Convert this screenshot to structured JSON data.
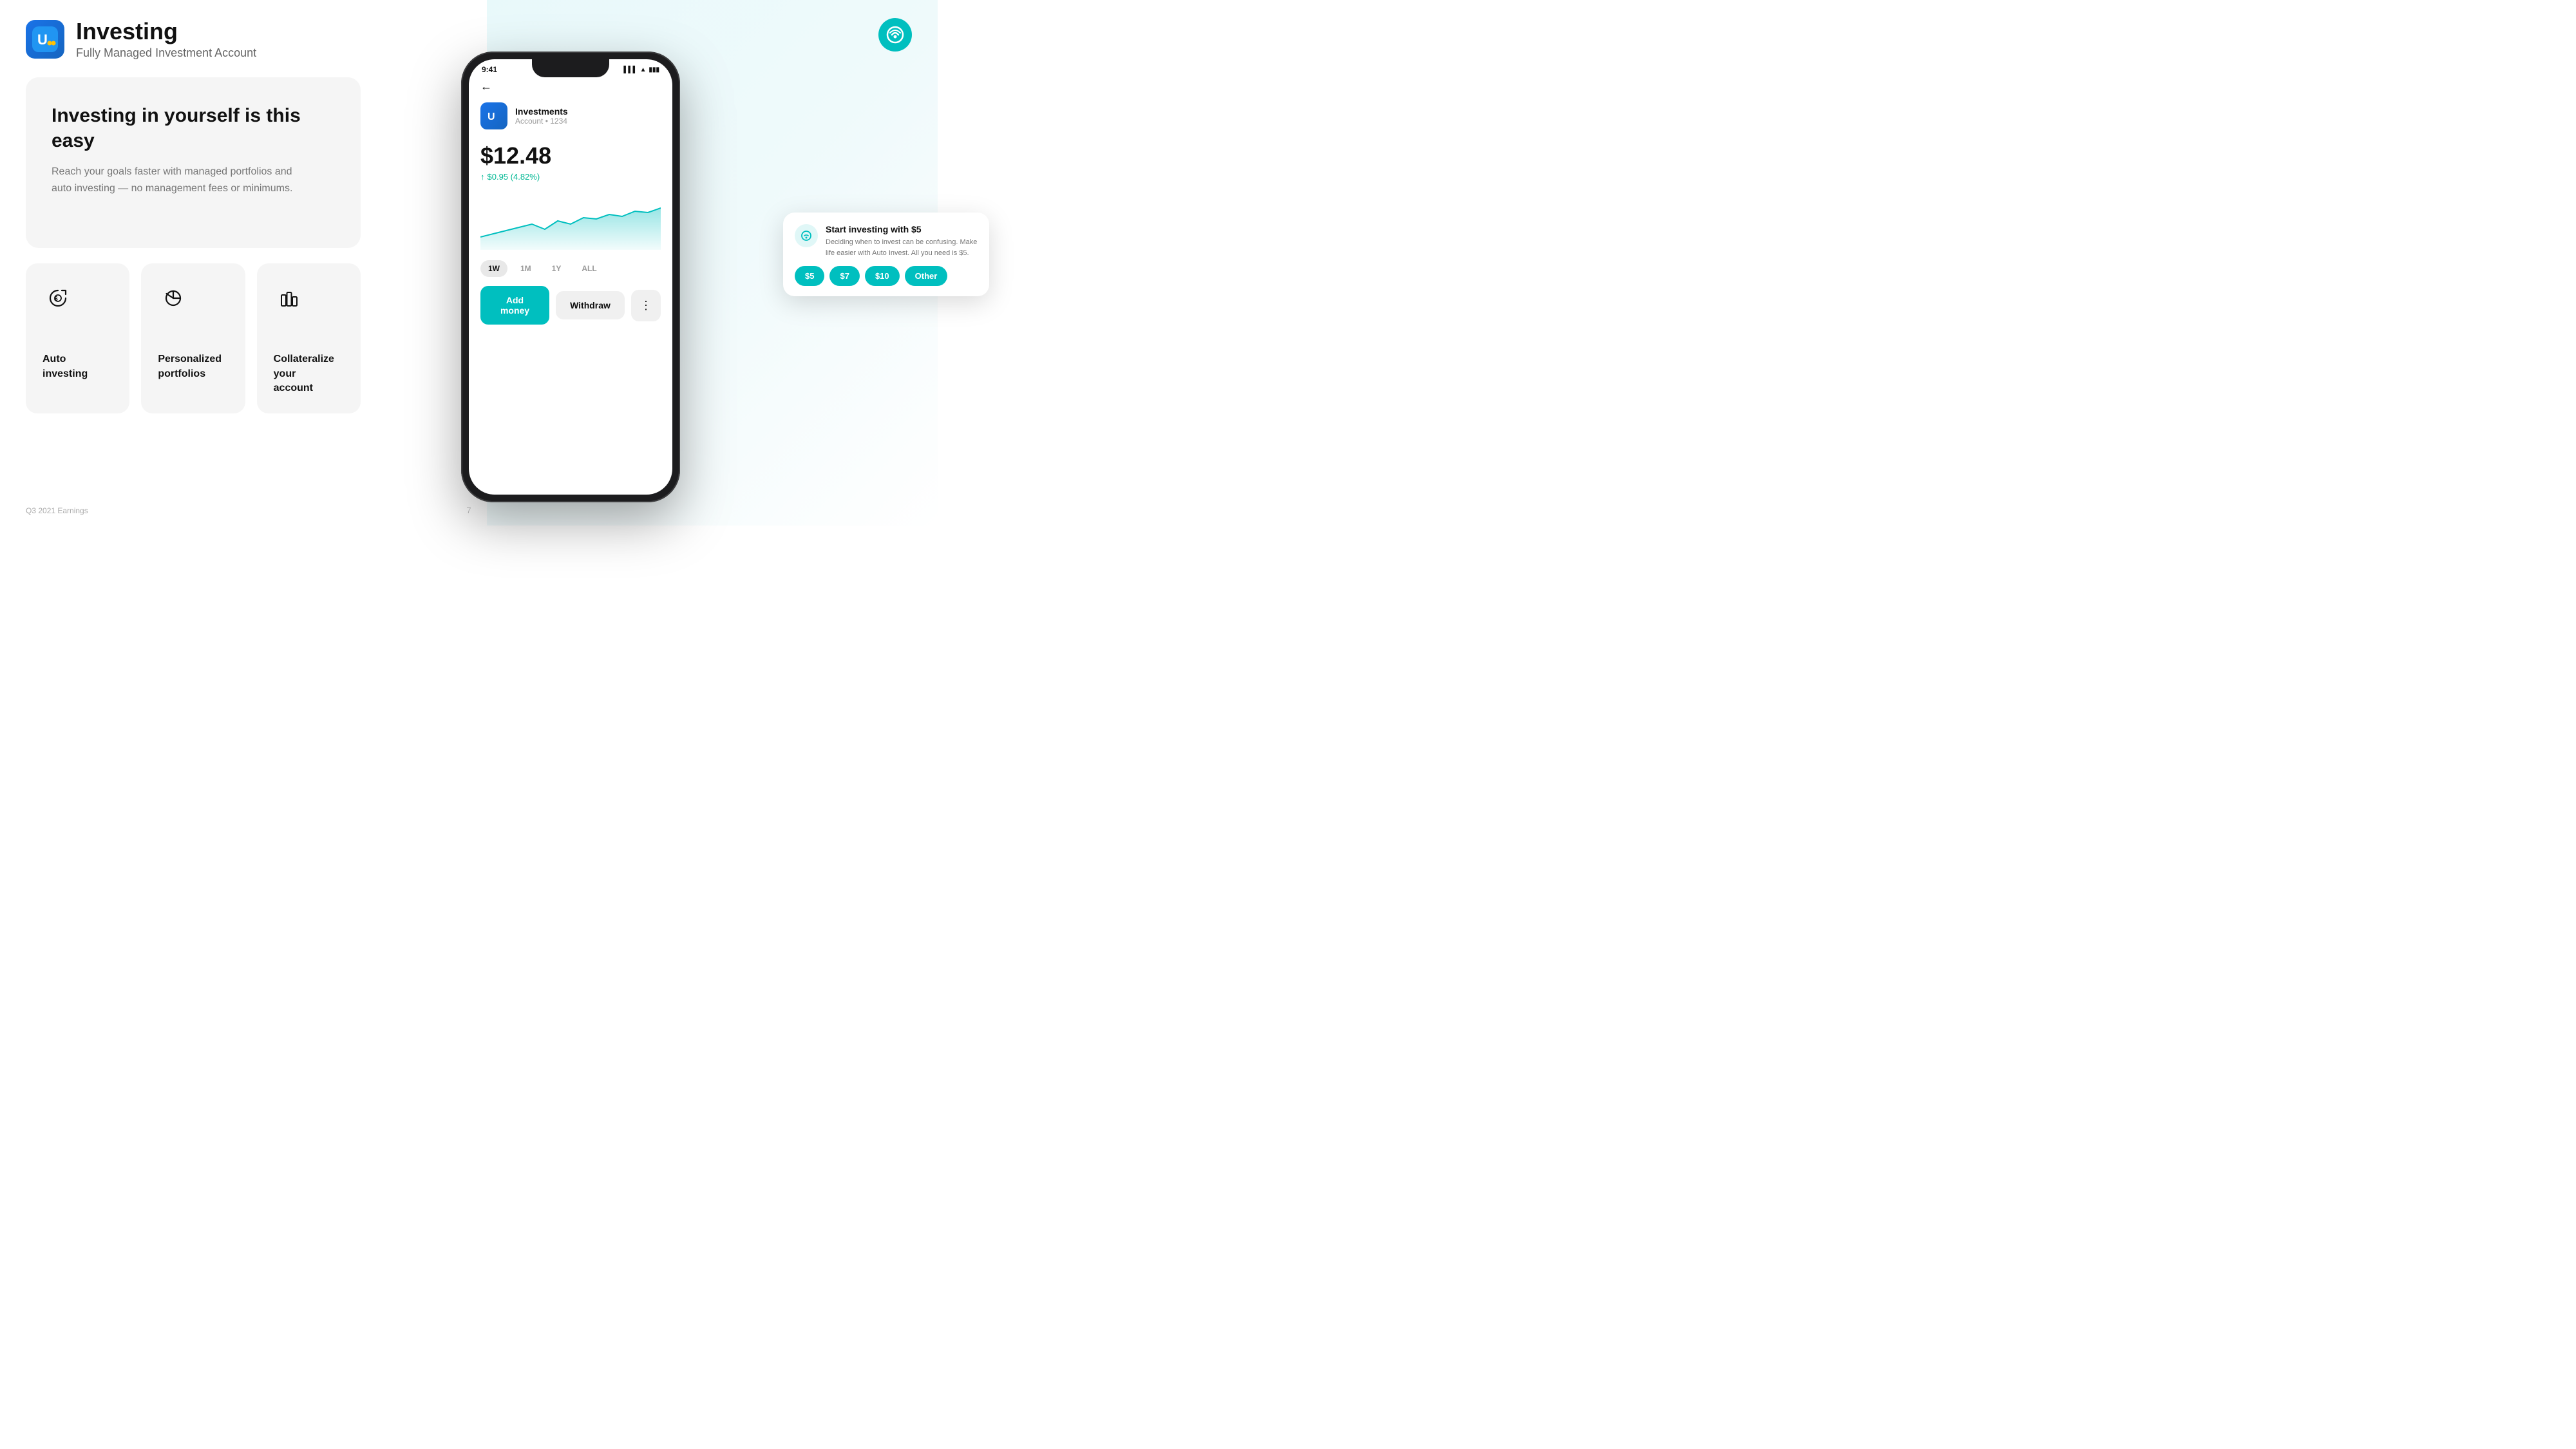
{
  "header": {
    "title": "Investing",
    "subtitle": "Fully Managed Investment Account"
  },
  "hero": {
    "title": "Investing in yourself is this easy",
    "description": "Reach your goals faster with managed portfolios and auto investing — no management fees or minimums."
  },
  "features": [
    {
      "id": "auto-investing",
      "label": "Auto\ninvesting",
      "icon": "auto-invest-icon"
    },
    {
      "id": "personalized-portfolios",
      "label": "Personalized\nportfolios",
      "icon": "pie-chart-icon"
    },
    {
      "id": "collateralize",
      "label": "Collateralize your\naccount",
      "icon": "bar-chart-icon"
    }
  ],
  "phone": {
    "time": "9:41",
    "account_name": "Investments",
    "account_number": "Account • 1234",
    "balance": "$12.48",
    "balance_change": "$0.95 (4.82%)",
    "invest_card": {
      "title": "Start investing with $5",
      "description": "Deciding when to invest can be confusing. Make life easier with Auto Invest. All you need is $5.",
      "buttons": [
        "$5",
        "$7",
        "$10",
        "Other"
      ]
    },
    "time_filters": [
      "1W",
      "1M",
      "1Y",
      "ALL"
    ],
    "active_filter": "1W",
    "buttons": {
      "add_money": "Add money",
      "withdraw": "Withdraw"
    }
  },
  "footer": {
    "label": "Q3 2021 Earnings",
    "page": "7"
  },
  "colors": {
    "teal": "#00bfbf",
    "teal_light": "#e0f7f7",
    "dark": "#1c1c1e",
    "blue": "#1a73e8"
  }
}
